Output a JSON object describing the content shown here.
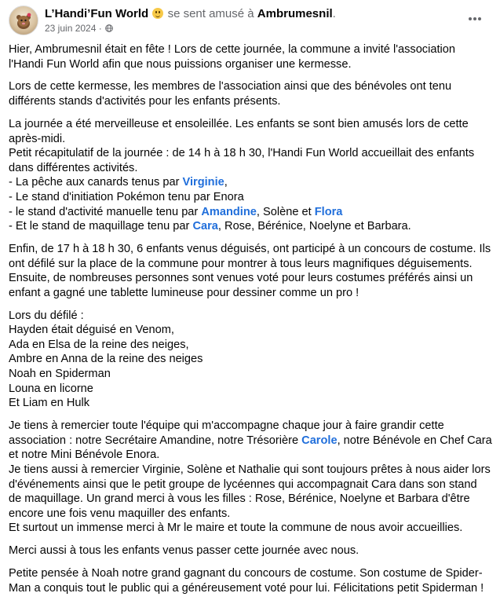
{
  "header": {
    "author": "L’Handi’Fun World",
    "feeling": "se sent amusé à",
    "place": "Ambrumesnil",
    "period": ".",
    "date": "23 juin 2024",
    "dot": " · "
  },
  "icons": {
    "feeling": "smiley-icon",
    "privacy": "globe-icon",
    "menu": "more-options-icon",
    "avatar": "page-avatar"
  },
  "colors": {
    "mention": "#216fdb",
    "secondary": "#65676b",
    "text": "#050505"
  },
  "paragraphs": [
    [
      {
        "t": "Hier, Ambrumesnil était en fête ! Lors de cette journée, la commune a invité l'association l'Handi Fun World afin que nous puissions organiser une kermesse."
      }
    ],
    [
      {
        "t": "Lors de cette kermesse, les membres de l'association ainsi que des bénévoles ont tenu différents stands d'activités pour les enfants présents."
      }
    ],
    [
      {
        "t": "La journée a été merveilleuse et ensoleillée. Les enfants se sont bien amusés lors de cette après-midi."
      },
      {
        "br": true
      },
      {
        "t": "Petit récapitulatif de la journée : de 14 h à 18 h 30, l'Handi Fun World accueillait des enfants dans différentes activités."
      },
      {
        "br": true
      },
      {
        "t": "- La pêche aux canards tenus par "
      },
      {
        "m": "Virginie"
      },
      {
        "t": ","
      },
      {
        "br": true
      },
      {
        "t": "- Le stand d'initiation Pokémon tenu par Enora"
      },
      {
        "br": true
      },
      {
        "t": "- le stand d'activité manuelle tenu par "
      },
      {
        "m": "Amandine"
      },
      {
        "t": ", Solène et "
      },
      {
        "m": "Flora"
      },
      {
        "br": true
      },
      {
        "t": "- Et le stand de maquillage tenu par "
      },
      {
        "m": "Cara"
      },
      {
        "t": ", Rose, Bérénice, Noelyne et Barbara."
      }
    ],
    [
      {
        "t": "Enfin, de 17 h à 18 h 30, 6 enfants venus déguisés, ont participé à un concours de costume. Ils ont défilé sur la place de la commune pour montrer à tous leurs magnifiques déguisements. Ensuite, de nombreuses personnes sont venues voté pour leurs costumes préférés ainsi un enfant a gagné une tablette lumineuse pour dessiner comme un pro !"
      }
    ],
    [
      {
        "t": "Lors du défilé :"
      },
      {
        "br": true
      },
      {
        "t": "Hayden était déguisé en Venom,"
      },
      {
        "br": true
      },
      {
        "t": "Ada en Elsa de la reine des neiges,"
      },
      {
        "br": true
      },
      {
        "t": "Ambre en Anna de la reine des neiges"
      },
      {
        "br": true
      },
      {
        "t": "Noah en Spiderman"
      },
      {
        "br": true
      },
      {
        "t": "Louna en licorne"
      },
      {
        "br": true
      },
      {
        "t": "Et Liam en Hulk"
      }
    ],
    [
      {
        "t": "Je tiens à remercier toute l'équipe qui m'accompagne chaque jour à faire grandir cette association : notre Secrétaire Amandine, notre Trésorière "
      },
      {
        "m": "Carole"
      },
      {
        "t": ", notre Bénévole en Chef Cara et notre Mini Bénévole Enora."
      },
      {
        "br": true
      },
      {
        "t": "Je tiens aussi à remercier Virginie, Solène et Nathalie qui sont toujours prêtes à nous aider lors d'événements ainsi que le petit groupe de lycéennes qui accompagnait Cara dans son stand de maquillage. Un grand merci à vous les filles : Rose, Bérénice, Noelyne et Barbara d'être encore une fois venu maquiller des enfants."
      },
      {
        "br": true
      },
      {
        "t": "Et surtout un immense merci à Mr le maire et toute la commune de nous avoir accueillies."
      }
    ],
    [
      {
        "t": "Merci aussi à tous les enfants venus passer cette journée avec nous."
      }
    ],
    [
      {
        "t": "Petite pensée à Noah notre grand gagnant du concours de costume. Son costume de Spider-Man a conquis tout le public qui a généreusement voté pour lui. Félicitations petit Spiderman !"
      }
    ]
  ]
}
